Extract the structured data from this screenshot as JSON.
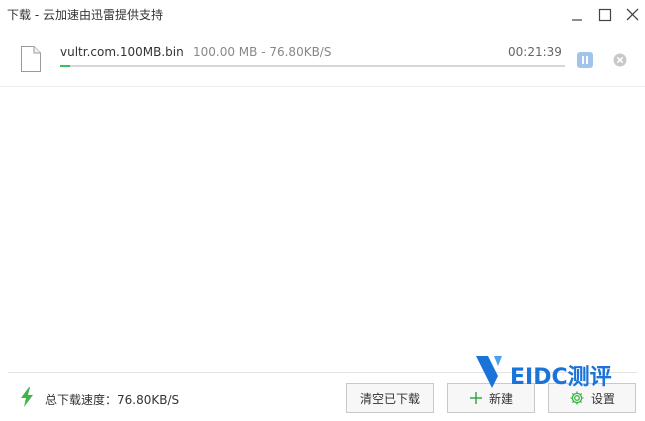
{
  "window": {
    "title": "下载 - 云加速由迅雷提供支持"
  },
  "download": {
    "file_name": "vultr.com.100MB.bin",
    "size_speed": "100.00 MB - 76.80KB/S",
    "time_remaining": "00:21:39",
    "progress_fraction": 0.02
  },
  "footer": {
    "total_speed": "总下载速度：76.80KB/S",
    "clear_label": "清空已下载",
    "new_label": "新建",
    "settings_label": "设置"
  },
  "watermark": {
    "text": "EIDC测评"
  },
  "colors": {
    "progress": "#33c35d",
    "pause": "#9fc6ea",
    "bolt": "#3fb549",
    "watermark": "#1a73d9"
  },
  "icons": {
    "minimize": "minimize-icon",
    "maximize": "maximize-icon",
    "close": "close-icon",
    "file": "file-icon",
    "pause": "pause-icon",
    "remove": "remove-circle-icon",
    "bolt": "lightning-bolt-icon",
    "plus": "plus-icon",
    "gear": "gear-icon"
  }
}
